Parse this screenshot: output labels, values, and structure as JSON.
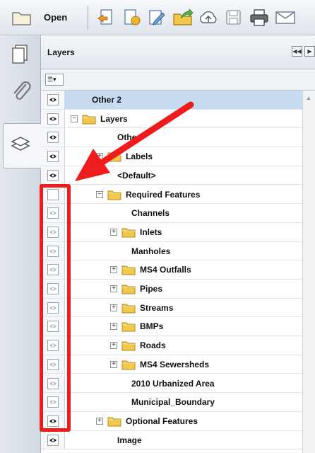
{
  "toolbar": {
    "open_label": "Open",
    "icons": [
      "folder-open-icon",
      "export-icon",
      "create-icon",
      "edit-icon",
      "share-icon",
      "upload-icon",
      "save-icon",
      "print-icon",
      "email-icon"
    ]
  },
  "sidebar": {
    "items": [
      "pages-icon",
      "attachments-icon",
      "layers-icon"
    ],
    "active": "layers-icon"
  },
  "panel": {
    "title": "Layers",
    "options_button_icon": "options-icon"
  },
  "layers": [
    {
      "label": "Other 2",
      "indent": 0,
      "expander": "",
      "folder": false,
      "eye": true,
      "selected": true
    },
    {
      "label": "Layers",
      "indent": 0,
      "expander": "−",
      "folder": true,
      "eye": true,
      "selected": false
    },
    {
      "label": "Other",
      "indent": 1,
      "expander": "",
      "folder": false,
      "eye": true,
      "selected": false
    },
    {
      "label": "Labels",
      "indent": 1,
      "expander": "+",
      "folder": true,
      "eye": true,
      "selected": false
    },
    {
      "label": "<Default>",
      "indent": 1,
      "expander": "",
      "folder": false,
      "eye": true,
      "selected": false
    },
    {
      "label": "Required Features",
      "indent": 1,
      "expander": "−",
      "folder": true,
      "eye": false,
      "selected": false
    },
    {
      "label": "Channels",
      "indent": 2,
      "expander": "",
      "folder": false,
      "eye": "dim",
      "selected": false
    },
    {
      "label": "Inlets",
      "indent": 2,
      "expander": "+",
      "folder": true,
      "eye": "dim",
      "selected": false
    },
    {
      "label": "Manholes",
      "indent": 2,
      "expander": "",
      "folder": false,
      "eye": "dim",
      "selected": false
    },
    {
      "label": "MS4 Outfalls",
      "indent": 2,
      "expander": "+",
      "folder": true,
      "eye": "dim",
      "selected": false
    },
    {
      "label": "Pipes",
      "indent": 2,
      "expander": "+",
      "folder": true,
      "eye": "dim",
      "selected": false
    },
    {
      "label": "Streams",
      "indent": 2,
      "expander": "+",
      "folder": true,
      "eye": "dim",
      "selected": false
    },
    {
      "label": "BMPs",
      "indent": 2,
      "expander": "+",
      "folder": true,
      "eye": "dim",
      "selected": false
    },
    {
      "label": "Roads",
      "indent": 2,
      "expander": "+",
      "folder": true,
      "eye": "dim",
      "selected": false
    },
    {
      "label": "MS4 Sewersheds",
      "indent": 2,
      "expander": "+",
      "folder": true,
      "eye": "dim",
      "selected": false
    },
    {
      "label": "2010 Urbanized Area",
      "indent": 2,
      "expander": "",
      "folder": false,
      "eye": "dim",
      "selected": false
    },
    {
      "label": "Municipal_Boundary",
      "indent": 2,
      "expander": "",
      "folder": false,
      "eye": "dim",
      "selected": false
    },
    {
      "label": "Optional Features",
      "indent": 1,
      "expander": "+",
      "folder": true,
      "eye": true,
      "selected": false
    },
    {
      "label": "Image",
      "indent": 1,
      "expander": "",
      "folder": false,
      "eye": true,
      "selected": false
    }
  ],
  "colors": {
    "annotation": "#ee1c1c",
    "selection": "#c7dbf0",
    "folder": "#f2c94c"
  }
}
